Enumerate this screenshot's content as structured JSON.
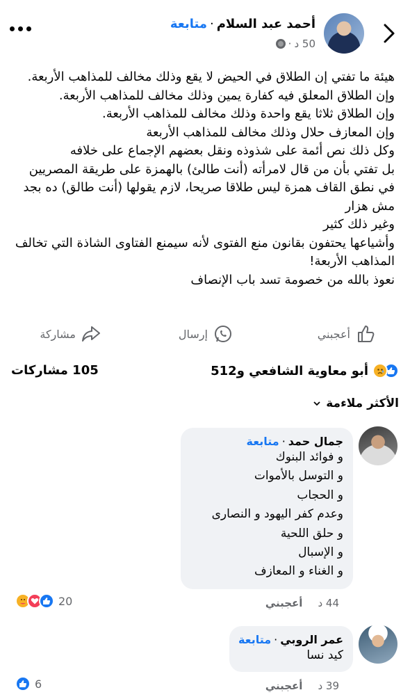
{
  "post": {
    "author": "أحمد عبد السلام",
    "follow": "متابعة",
    "time": "50 د",
    "text": [
      "هيئة ما تفتي إن الطلاق في الحيض لا يقع وذلك مخالف للمذاهب الأربعة.",
      "وإن الطلاق المعلق فيه كفارة يمين وذلك مخالف للمذاهب الأربعة.",
      "وإن الطلاق ثلاثا يقع واحدة وذلك مخالف للمذاهب الأربعة.",
      "وإن المعازف حلال وذلك مخالف للمذاهب الأربعة",
      "وكل ذلك نص أئمة على شذوذه ونقل بعضهم الإجماع على خلافه",
      "بل تفتي بأن من قال لامرأته (أنت طالئ) بالهمزة على طريقة المصريين في نطق القاف همزة ليس طلاقا صريحا، لازم يقولها (أنت طالق) ده بجد مش هزار",
      "وغير ذلك كثير",
      "وأشياعها يحتفون بقانون منع الفتوى لأنه سيمنع الفتاوى الشاذة التي تخالف المذاهب الأربعة!",
      "نعوذ بالله من خصومة تسد باب الإنصاف"
    ]
  },
  "actions": {
    "like": "أعجبني",
    "send": "إرسال",
    "share": "مشاركة"
  },
  "summary": {
    "reactors": "أبو معاوية الشافعي و512",
    "shares": "105 مشاركات"
  },
  "sort_label": "الأكثر ملاءمة",
  "comments": [
    {
      "name": "جمال حمد",
      "follow": "متابعة",
      "lines": [
        "و فوائد البنوك",
        "و التوسل بالأموات",
        "و الحجاب",
        "وعدم كفر اليهود و النصارى",
        "و حلق اللحية",
        "و الإسبال",
        "و الغناء و المعازف"
      ],
      "time": "44 د",
      "like": "أعجبني",
      "reaction_count": "20"
    },
    {
      "name": "عمر الروبي",
      "follow": "متابعة",
      "lines": [
        "كيد نسا"
      ],
      "time": "39 د",
      "like": "أعجبني",
      "reaction_count": "6"
    }
  ],
  "colors": {
    "accent": "#1877f2",
    "secondary_text": "#65676b",
    "bubble": "#f0f2f5"
  }
}
